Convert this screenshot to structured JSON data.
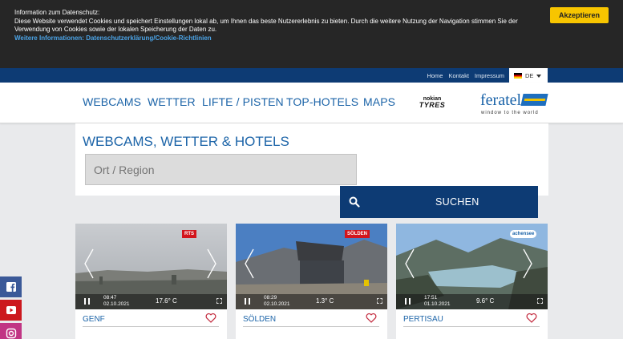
{
  "cookie_banner": {
    "title": "Information zum Datenschutz:",
    "body": "Diese Website verwendet Cookies und speichert Einstellungen lokal ab, um Ihnen das beste Nutzererlebnis zu bieten. Durch die weitere Nutzung der Navigation stimmen Sie der Verwendung von Cookies sowie der lokalen Speicherung der Daten zu.",
    "link": "Weitere Informationen: Datenschutzerklärung/Cookie-Richtlinien",
    "accept_label": "Akzeptieren"
  },
  "utility": {
    "links": [
      "Home",
      "Kontakt",
      "Impressum"
    ],
    "language": "DE"
  },
  "nav": {
    "items": [
      "WEBCAMS",
      "WETTER",
      "LIFTE / PISTEN",
      "TOP-HOTELS",
      "MAPS"
    ],
    "sponsor_line1": "nokian",
    "sponsor_line2": "TYRES",
    "brand": "feratel",
    "brand_tagline": "window to the world"
  },
  "search": {
    "title": "WEBCAMS, WETTER & HOTELS",
    "placeholder": "Ort / Region",
    "button_label": "SUCHEN"
  },
  "webcams": [
    {
      "name": "GENF",
      "time": "08:47",
      "date": "02.10.2021",
      "temp": "17.6° C",
      "badge": "RTS"
    },
    {
      "name": "SÖLDEN",
      "time": "08:29",
      "date": "02.10.2021",
      "temp": "1.3° C",
      "badge": "SÖLDEN"
    },
    {
      "name": "PERTISAU",
      "time": "17:51",
      "date": "01.10.2021",
      "temp": "9.6° C",
      "badge": "achensee"
    }
  ],
  "social": [
    "facebook-icon",
    "youtube-icon",
    "instagram-icon"
  ],
  "colors": {
    "primary": "#1c64a8",
    "dark_blue": "#0d3b74",
    "accept": "#f7c500"
  }
}
